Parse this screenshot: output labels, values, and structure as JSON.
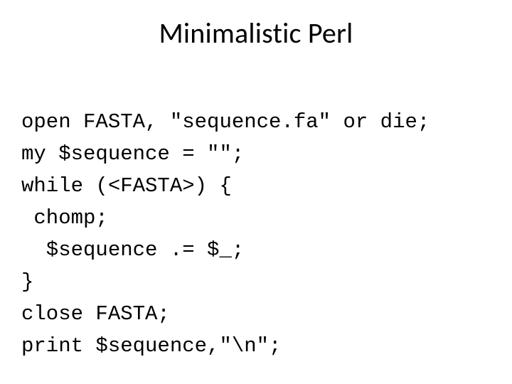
{
  "title": "Minimalistic Perl",
  "code": {
    "l1": "open FASTA, \"sequence.fa\" or die;",
    "l2": "my $sequence = \"\";",
    "l3": "while (<FASTA>) {",
    "l4": " chomp;",
    "l5": "  $sequence .= $_;",
    "l6": "}",
    "l7": "close FASTA;",
    "l8": "print $sequence,\"\\n\";"
  }
}
